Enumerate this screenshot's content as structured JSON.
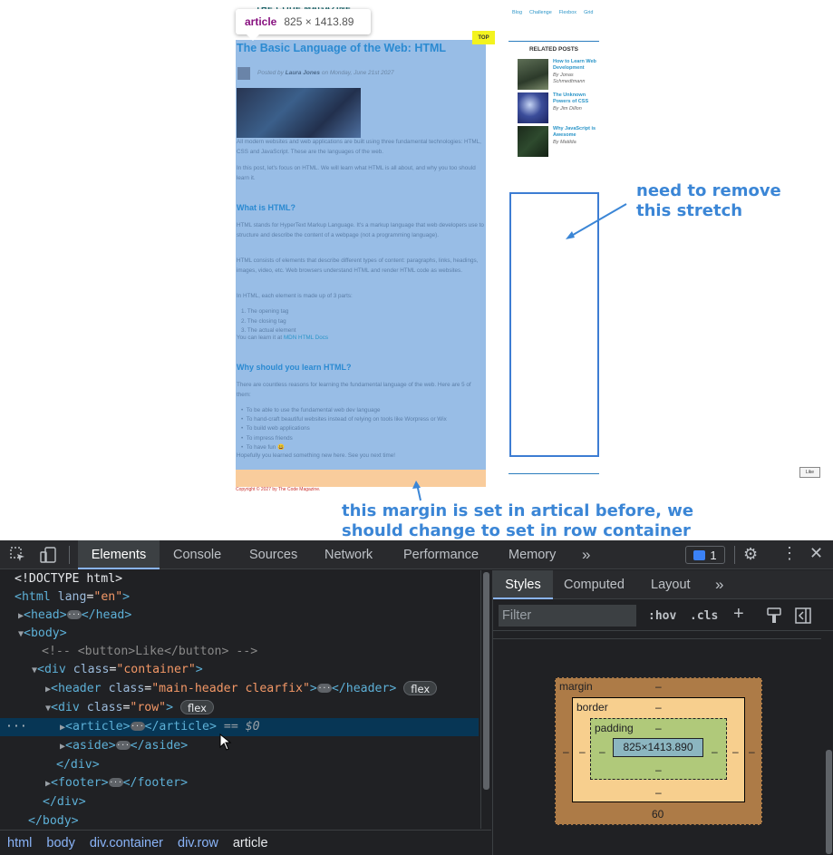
{
  "page": {
    "logo_partial": "THE CODE MAGAZINE",
    "nav": [
      "Blog",
      "Challenge",
      "Flexbox",
      "Grid"
    ],
    "tooltip": {
      "tag": "article",
      "dims": "825 × 1413.89"
    },
    "top_badge": "TOP",
    "article": {
      "title": "The Basic Language of the Web: HTML",
      "byline_prefix": "Posted by",
      "author": "Laura Jones",
      "byline_suffix": "on Monday, June 21st 2027",
      "p1": "All modern websites and web applications are built using three fundamental technologies: HTML, CSS and JavaScript. These are the languages of the web.",
      "p2": "In this post, let's focus on HTML. We will learn what HTML is all about, and why you too should learn it.",
      "h2_1": "What is HTML?",
      "p3": "HTML stands for HyperText Markup Language. It's a markup language that web developers use to structure and describe the content of a webpage (not a programming language).",
      "p4": "HTML consists of elements that describe different types of content: paragraphs, links, headings, images, video, etc. Web browsers understand HTML and render HTML code as websites.",
      "p5": "In HTML, each element is made up of 3 parts:",
      "ol": [
        "The opening tag",
        "The closing tag",
        "The actual element"
      ],
      "learn_prefix": "You can learn it at",
      "learn_link": "MDN HTML Docs",
      "h2_2": "Why should you learn HTML?",
      "p6": "There are countless reasons for learning the fundamental language of the web. Here are 5 of them:",
      "ul": [
        "To be able to use the fundamental web dev language",
        "To hand-craft beautiful websites instead of relying on tools like Worpress or Wix",
        "To build web applications",
        "To impress friends",
        "To have fun 😃"
      ],
      "closing": "Hopefully you learned something new here. See you next time!"
    },
    "copyright": "Copyright © 2027 by The Code Magazine.",
    "aside": {
      "title": "RELATED POSTS",
      "items": [
        {
          "title": "How to Learn Web Development",
          "by": "By Jonas Schmedtmann"
        },
        {
          "title": "The Unknown Powers of CSS",
          "by": "By Jim Dillon"
        },
        {
          "title": "Why JavaScript is Awesome",
          "by": "By Matilda"
        }
      ]
    },
    "like_button": "Like"
  },
  "annotations": {
    "stretch_note_1": "need to remove",
    "stretch_note_2": "this stretch",
    "margin_note_1": "this margin is set in artical before, we",
    "margin_note_2": "should change to set in row container"
  },
  "devtools": {
    "tabs": [
      "Elements",
      "Console",
      "Sources",
      "Network",
      "Performance",
      "Memory"
    ],
    "more_tabs": "»",
    "issues_count": "1",
    "dom": {
      "doctype": "<!DOCTYPE html>",
      "html_open_tag": "html",
      "html_lang_attr": "lang",
      "html_lang_val": "\"en\"",
      "head": "head",
      "body": "body",
      "comment": "<!-- <button>Like</button> -->",
      "container_tag": "div",
      "class_attr": "class",
      "container_class": "\"container\"",
      "header_tag": "header",
      "header_class": "\"main-header clearfix\"",
      "flex": "flex",
      "row_class": "\"row\"",
      "article_tag": "article",
      "selected_suffix": "== $0",
      "aside_tag": "aside",
      "div_close": "</div>",
      "footer_tag": "footer",
      "body_close": "</body>"
    },
    "breadcrumbs": [
      "html",
      "body",
      "div.container",
      "div.row",
      "article"
    ],
    "styles_tabs": [
      "Styles",
      "Computed",
      "Layout"
    ],
    "filter_placeholder": "Filter",
    "hov": ":hov",
    "cls": ".cls",
    "box_model": {
      "margin_label": "margin",
      "border_label": "border",
      "padding_label": "padding",
      "content": "825×1413.890",
      "dash": "–",
      "margin_bottom": "60"
    }
  }
}
